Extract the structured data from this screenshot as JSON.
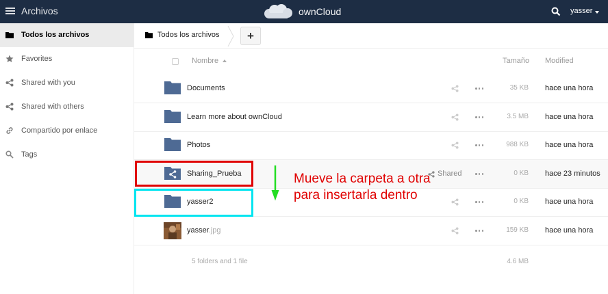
{
  "header": {
    "app_name": "Archivos",
    "brand": "ownCloud",
    "user": "yasser",
    "icons": [
      "menu-icon",
      "owncloud-logo",
      "search-icon",
      "chevron-down-icon"
    ],
    "bg_color": "#1d2d44"
  },
  "sidebar": {
    "items": [
      {
        "label": "Todos los archivos",
        "icon": "folder-icon",
        "active": true
      },
      {
        "label": "Favorites",
        "icon": "star-icon"
      },
      {
        "label": "Shared with you",
        "icon": "share-icon"
      },
      {
        "label": "Shared with others",
        "icon": "share-icon"
      },
      {
        "label": "Compartido por enlace",
        "icon": "link-icon"
      },
      {
        "label": "Tags",
        "icon": "tag-icon"
      }
    ]
  },
  "breadcrumb": {
    "label": "Todos los archivos",
    "add_label": "+"
  },
  "table": {
    "columns": {
      "name": "Nombre",
      "size": "Tamaño",
      "modified": "Modified"
    },
    "rows": [
      {
        "name": "Documents",
        "ext": "",
        "type": "folder",
        "size": "35 KB",
        "modified": "hace una hora",
        "share": ""
      },
      {
        "name": "Learn more about ownCloud",
        "ext": "",
        "type": "folder",
        "size": "3.5 MB",
        "modified": "hace una hora",
        "share": ""
      },
      {
        "name": "Photos",
        "ext": "",
        "type": "folder",
        "size": "988 KB",
        "modified": "hace una hora",
        "share": ""
      },
      {
        "name": "Sharing_Prueba",
        "ext": "",
        "type": "shared-folder",
        "size": "0 KB",
        "modified": "hace 23 minutos",
        "share": "Shared"
      },
      {
        "name": "yasser2",
        "ext": "",
        "type": "folder",
        "size": "0 KB",
        "modified": "hace una hora",
        "share": ""
      },
      {
        "name": "yasser",
        "ext": ".jpg",
        "type": "image",
        "size": "159 KB",
        "modified": "hace una hora",
        "share": ""
      }
    ],
    "summary": {
      "count": "5 folders and 1 file",
      "total": "4.6 MB"
    }
  },
  "annotation": {
    "line1": "Mueve la carpeta a otra",
    "line2": "para insertarla dentro",
    "colors": {
      "text": "#e00000",
      "source_box": "#e00000",
      "target_box": "#00e5f0",
      "arrow": "#22dd22"
    }
  }
}
